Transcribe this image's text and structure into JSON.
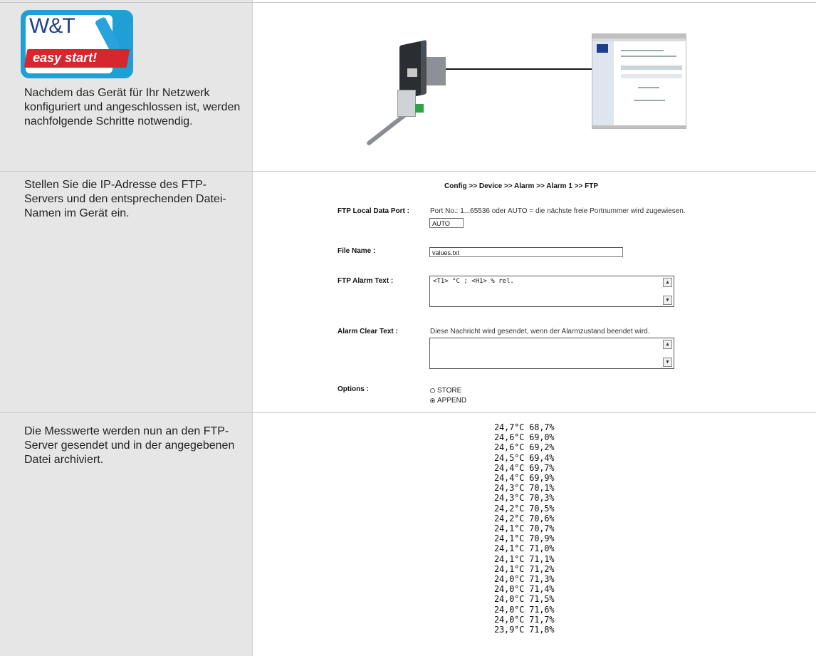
{
  "logo": {
    "brand": "W&T",
    "tagline": "easy start!"
  },
  "steps": [
    {
      "description": "Nachdem das Gerät für Ihr Netzwerk konfiguriert und angeschlossen ist, werden nachfolgende Schritte notwendig."
    },
    {
      "description": "Stellen Sie die IP-Adresse des FTP-Servers und den entsprechenden Datei-Namen im Gerät ein."
    },
    {
      "description": "Die Messwerte werden nun an den FTP-Server gesendet und in der angegebenen Datei archiviert."
    }
  ],
  "form": {
    "breadcrumb": "Config >> Device >> Alarm >> Alarm 1 >> FTP",
    "ftp_local_port": {
      "label": "FTP Local Data Port :",
      "hint": "Port No.: 1...65536 oder AUTO = die nächste freie Portnummer wird zugewiesen.",
      "value": "AUTO"
    },
    "file_name": {
      "label": "File Name :",
      "value": "values.txt"
    },
    "ftp_alarm_text": {
      "label": "FTP Alarm Text :",
      "value": "<T1> °C ; <H1> % rel."
    },
    "alarm_clear_text": {
      "label": "Alarm Clear Text :",
      "hint": "Diese Nachricht wird gesendet, wenn der Alarmzustand beendet wird.",
      "value": ""
    },
    "options": {
      "label": "Options :",
      "items": [
        {
          "label": "STORE",
          "selected": false
        },
        {
          "label": "APPEND",
          "selected": true
        }
      ]
    },
    "scroll_up": "▲",
    "scroll_down": "▼"
  },
  "measurements": [
    "24,7°C 68,7%",
    "24,6°C 69,0%",
    "24,6°C 69,2%",
    "24,5°C 69,4%",
    "24,4°C 69,7%",
    "24,4°C 69,9%",
    "24,3°C 70,1%",
    "24,3°C 70,3%",
    "24,2°C 70,5%",
    "24,2°C 70,6%",
    "24,1°C 70,7%",
    "24,1°C 70,9%",
    "24,1°C 71,0%",
    "24,1°C 71,1%",
    "24,1°C 71,2%",
    "24,0°C 71,3%",
    "24,0°C 71,4%",
    "24,0°C 71,5%",
    "24,0°C 71,6%",
    "24,0°C 71,7%",
    "23,9°C 71,8%"
  ]
}
